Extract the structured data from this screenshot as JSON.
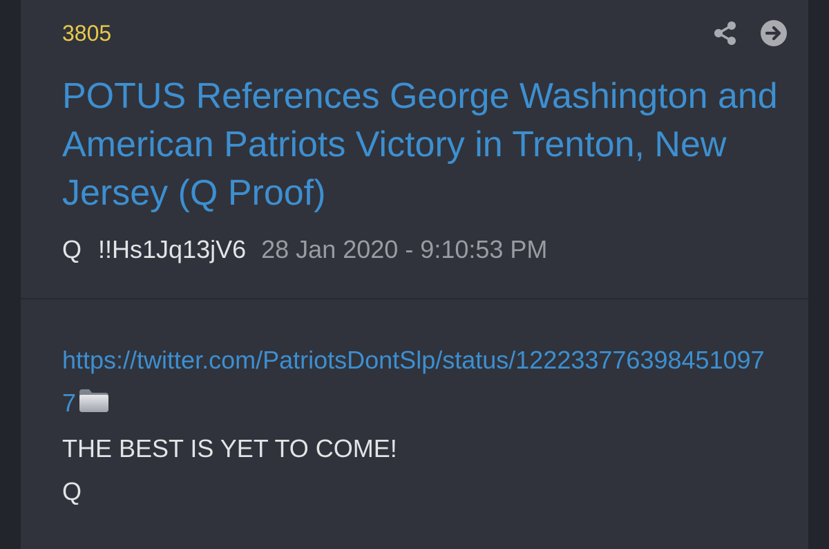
{
  "post": {
    "number": "3805",
    "title": "POTUS References George Washington and American Patriots Victory in Trenton, New Jersey (Q Proof)",
    "author": "Q",
    "tripcode": "!!Hs1Jq13jV6",
    "timestamp": "28 Jan 2020 - 9:10:53 PM",
    "link": "https://twitter.com/PatriotsDontSlp/status/1222337763984510977",
    "body_lines": [
      "THE BEST IS YET TO COME!",
      "Q"
    ]
  },
  "icons": {
    "share": "share-icon",
    "open": "arrow-right-circle-icon",
    "folder": "folder-icon"
  },
  "colors": {
    "background": "#22252b",
    "card": "#30333b",
    "post_number": "#e9c94a",
    "accent_link": "#3d8fd1",
    "text": "#e3e4e6",
    "muted": "#9a9ca3",
    "icon": "#a9abb1"
  }
}
